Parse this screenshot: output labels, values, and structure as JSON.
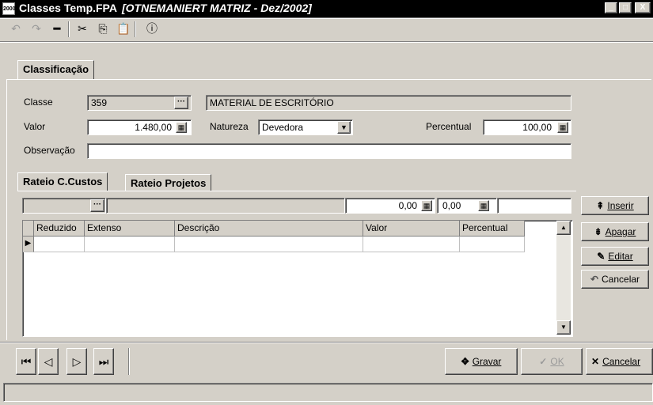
{
  "window": {
    "icon_label": "2000",
    "title": "Classes Temp.FPA",
    "subtitle": "[OTNEMANIERT MATRIZ - Dez/2002]",
    "controls": {
      "minimize": "_",
      "maximize": "□",
      "close": "X"
    }
  },
  "toolbar": {
    "undo": "↶",
    "redo": "↷",
    "delete": "━",
    "cut": "✂",
    "copy": "⎘",
    "paste": "📋",
    "info": "ⓘ"
  },
  "tabs": {
    "main": "Classificação"
  },
  "form": {
    "classe_label": "Classe",
    "classe_value": "359",
    "classe_description": "MATERIAL DE ESCRITÓRIO",
    "valor_label": "Valor",
    "valor_value": "1.480,00",
    "natureza_label": "Natureza",
    "natureza_value": "Devedora",
    "percentual_label": "Percentual",
    "percentual_value": "100,00",
    "observacao_label": "Observação",
    "observacao_value": ""
  },
  "subtabs": {
    "rateio_custos": "Rateio C.Custos",
    "rateio_projetos": "Rateio Projetos"
  },
  "filter": {
    "code": "",
    "name": "",
    "valor": "0,00",
    "percentual": "0,00",
    "extra": ""
  },
  "grid": {
    "columns": [
      "Reduzido",
      "Extenso",
      "Descrição",
      "Valor",
      "Percentual"
    ],
    "rows": [
      [
        "",
        "",
        "",
        "",
        ""
      ]
    ],
    "row_indicator": "▶"
  },
  "side_buttons": {
    "inserir": "Inserir",
    "apagar": "Apagar",
    "editar": "Editar",
    "cancelar": "Cancelar"
  },
  "nav": {
    "first": "⏮",
    "prev": "◁",
    "next": "▷",
    "last": "⏭"
  },
  "actions": {
    "gravar": "Gravar",
    "ok": "OK",
    "cancelar": "Cancelar"
  },
  "colors": {
    "face": "#d4d0c8",
    "titlebar": "#000000",
    "disabled": "#9a9a9a"
  }
}
